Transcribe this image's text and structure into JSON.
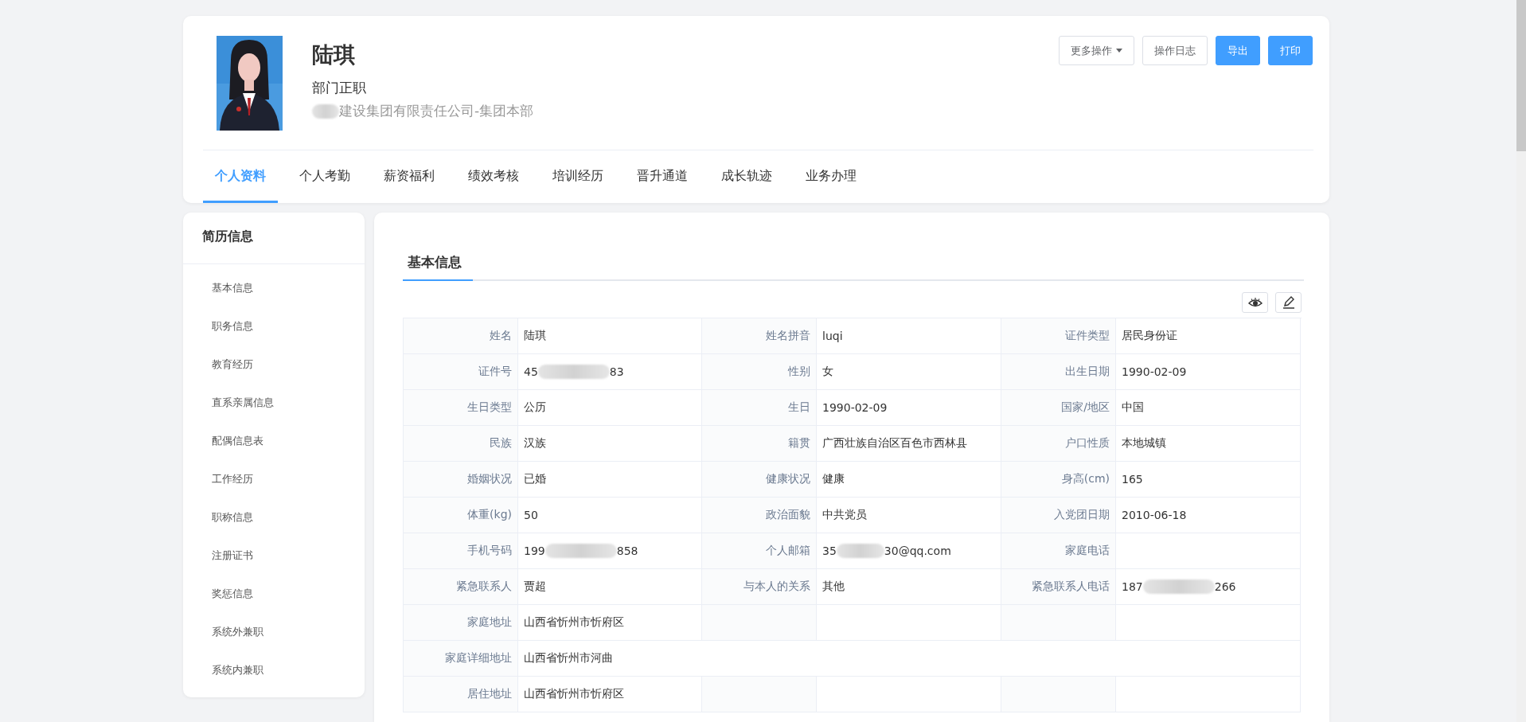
{
  "profile": {
    "name": "陆琪",
    "position": "部门正职",
    "company": "建设集团有限责任公司-集团本部",
    "company_redacted_prefix": true
  },
  "actions": [
    {
      "label": "更多操作",
      "kind": "dropdown"
    },
    {
      "label": "操作日志",
      "kind": "default"
    },
    {
      "label": "导出",
      "kind": "primary"
    },
    {
      "label": "打印",
      "kind": "primary"
    }
  ],
  "tabs": [
    {
      "label": "个人资料",
      "selected": true
    },
    {
      "label": "个人考勤",
      "selected": false
    },
    {
      "label": "薪资福利",
      "selected": false
    },
    {
      "label": "绩效考核",
      "selected": false
    },
    {
      "label": "培训经历",
      "selected": false
    },
    {
      "label": "晋升通道",
      "selected": false
    },
    {
      "label": "成长轨迹",
      "selected": false
    },
    {
      "label": "业务办理",
      "selected": false
    }
  ],
  "sidebar": {
    "title": "简历信息",
    "items": [
      "基本信息",
      "职务信息",
      "教育经历",
      "直系亲属信息",
      "配偶信息表",
      "工作经历",
      "职称信息",
      "注册证书",
      "奖惩信息",
      "系统外兼职",
      "系统内兼职"
    ]
  },
  "section": {
    "title": "基本信息"
  },
  "rows": [
    {
      "kind": "grid",
      "fields": [
        {
          "label": "姓名",
          "value": "陆琪"
        },
        {
          "label": "姓名拼音",
          "value": "luqi"
        },
        {
          "label": "证件类型",
          "value": "居民身份证"
        }
      ]
    },
    {
      "kind": "grid",
      "fields": [
        {
          "label": "证件号",
          "value": "45",
          "value_end": "83",
          "redacted": true
        },
        {
          "label": "性别",
          "value": "女"
        },
        {
          "label": "出生日期",
          "value": "1990-02-09"
        }
      ]
    },
    {
      "kind": "grid",
      "fields": [
        {
          "label": "生日类型",
          "value": "公历"
        },
        {
          "label": "生日",
          "value": "1990-02-09"
        },
        {
          "label": "国家/地区",
          "value": "中国"
        }
      ]
    },
    {
      "kind": "grid",
      "fields": [
        {
          "label": "民族",
          "value": "汉族"
        },
        {
          "label": "籍贯",
          "value": "广西壮族自治区百色市西林县"
        },
        {
          "label": "户口性质",
          "value": "本地城镇"
        }
      ]
    },
    {
      "kind": "grid",
      "fields": [
        {
          "label": "婚姻状况",
          "value": "已婚"
        },
        {
          "label": "健康状况",
          "value": "健康"
        },
        {
          "label": "身高(cm)",
          "value": "165"
        }
      ]
    },
    {
      "kind": "grid",
      "fields": [
        {
          "label": "体重(kg)",
          "value": "50"
        },
        {
          "label": "政治面貌",
          "value": "中共党员"
        },
        {
          "label": "入党团日期",
          "value": "2010-06-18"
        }
      ]
    },
    {
      "kind": "grid",
      "fields": [
        {
          "label": "手机号码",
          "value": "199",
          "value_end": "858",
          "redacted": true
        },
        {
          "label": "个人邮箱",
          "value": "35",
          "value_end": "30@qq.com",
          "redacted": true
        },
        {
          "label": "家庭电话"
        }
      ]
    },
    {
      "kind": "grid",
      "fields": [
        {
          "label": "紧急联系人",
          "value": "贾超"
        },
        {
          "label": "与本人的关系",
          "value": "其他"
        },
        {
          "label": "紧急联系人电话",
          "value": "187",
          "value_end": "266",
          "redacted": true
        }
      ]
    },
    {
      "kind": "grid",
      "fields": [
        {
          "label": "家庭地址",
          "value": "山西省忻州市忻府区"
        }
      ]
    },
    {
      "kind": "wide",
      "fields": [
        {
          "label": "家庭详细地址",
          "value": "山西省忻州市河曲"
        }
      ]
    },
    {
      "kind": "grid",
      "fields": [
        {
          "label": "居住地址",
          "value": "山西省忻州市忻府区"
        }
      ]
    }
  ]
}
